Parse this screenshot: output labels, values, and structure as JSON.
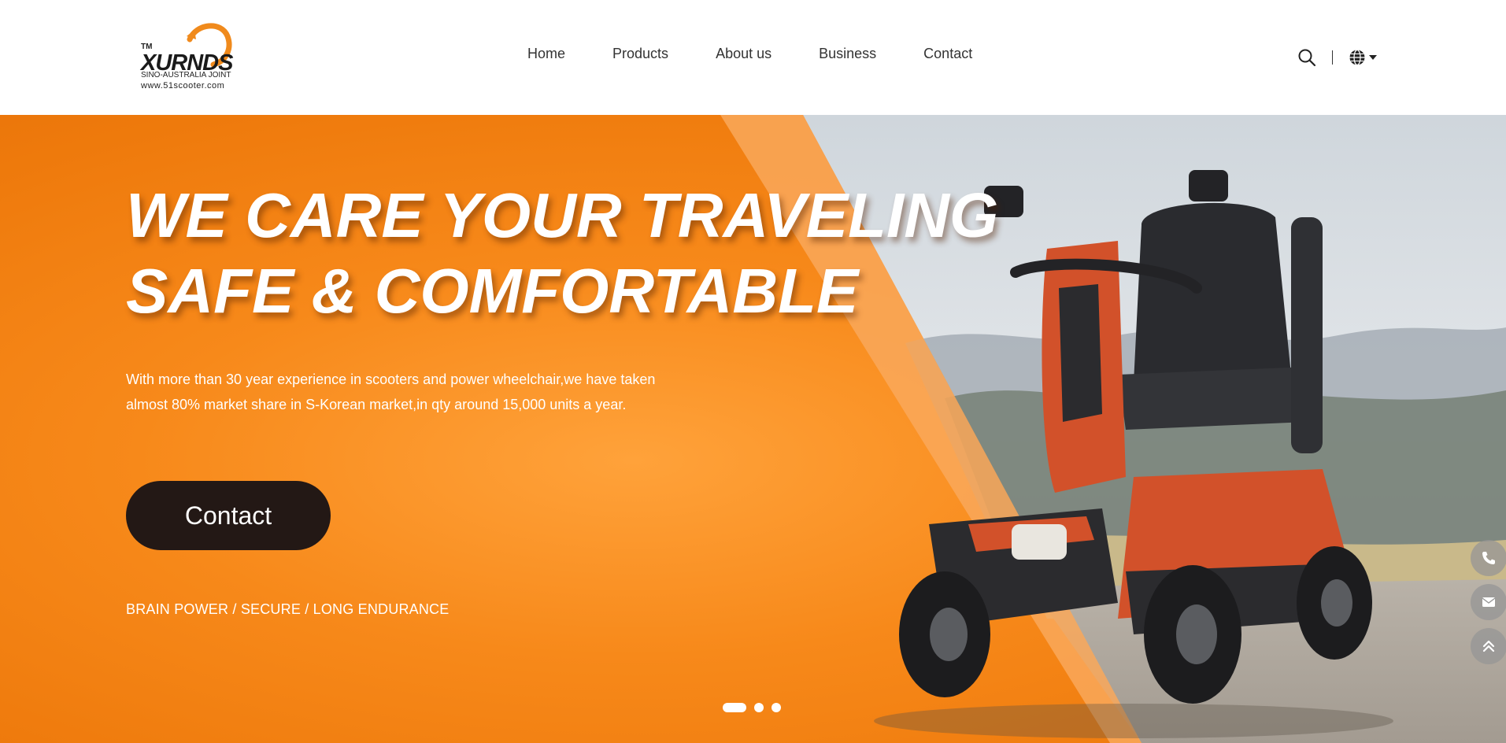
{
  "logo": {
    "tm": "TM",
    "brand": "XURNDS",
    "subtitle": "SINO-AUSTRALIA JOINT",
    "url": "www.51scooter.com",
    "accent_color": "#f08a1c"
  },
  "nav": {
    "items": [
      {
        "label": "Home"
      },
      {
        "label": "Products"
      },
      {
        "label": "About us"
      },
      {
        "label": "Business"
      },
      {
        "label": "Contact"
      }
    ]
  },
  "tools": {
    "search_icon": "search-icon",
    "language_icon": "globe-icon"
  },
  "hero": {
    "headline_line1": "WE CARE YOUR TRAVELING",
    "headline_line2": "SAFE & COMFORTABLE",
    "description": "With more than 30 year experience in scooters and power wheelchair,we have taken almost 80% market share in S-Korean market,in qty around 15,000 units a year.",
    "cta_label": "Contact",
    "features": "BRAIN POWER / SECURE / LONG ENDURANCE",
    "background_color": "#f7891a",
    "slides": [
      {
        "active": true
      },
      {
        "active": false
      },
      {
        "active": false
      }
    ]
  },
  "side_tools": [
    {
      "icon": "phone-icon"
    },
    {
      "icon": "mail-icon"
    },
    {
      "icon": "back-to-top-icon"
    }
  ]
}
